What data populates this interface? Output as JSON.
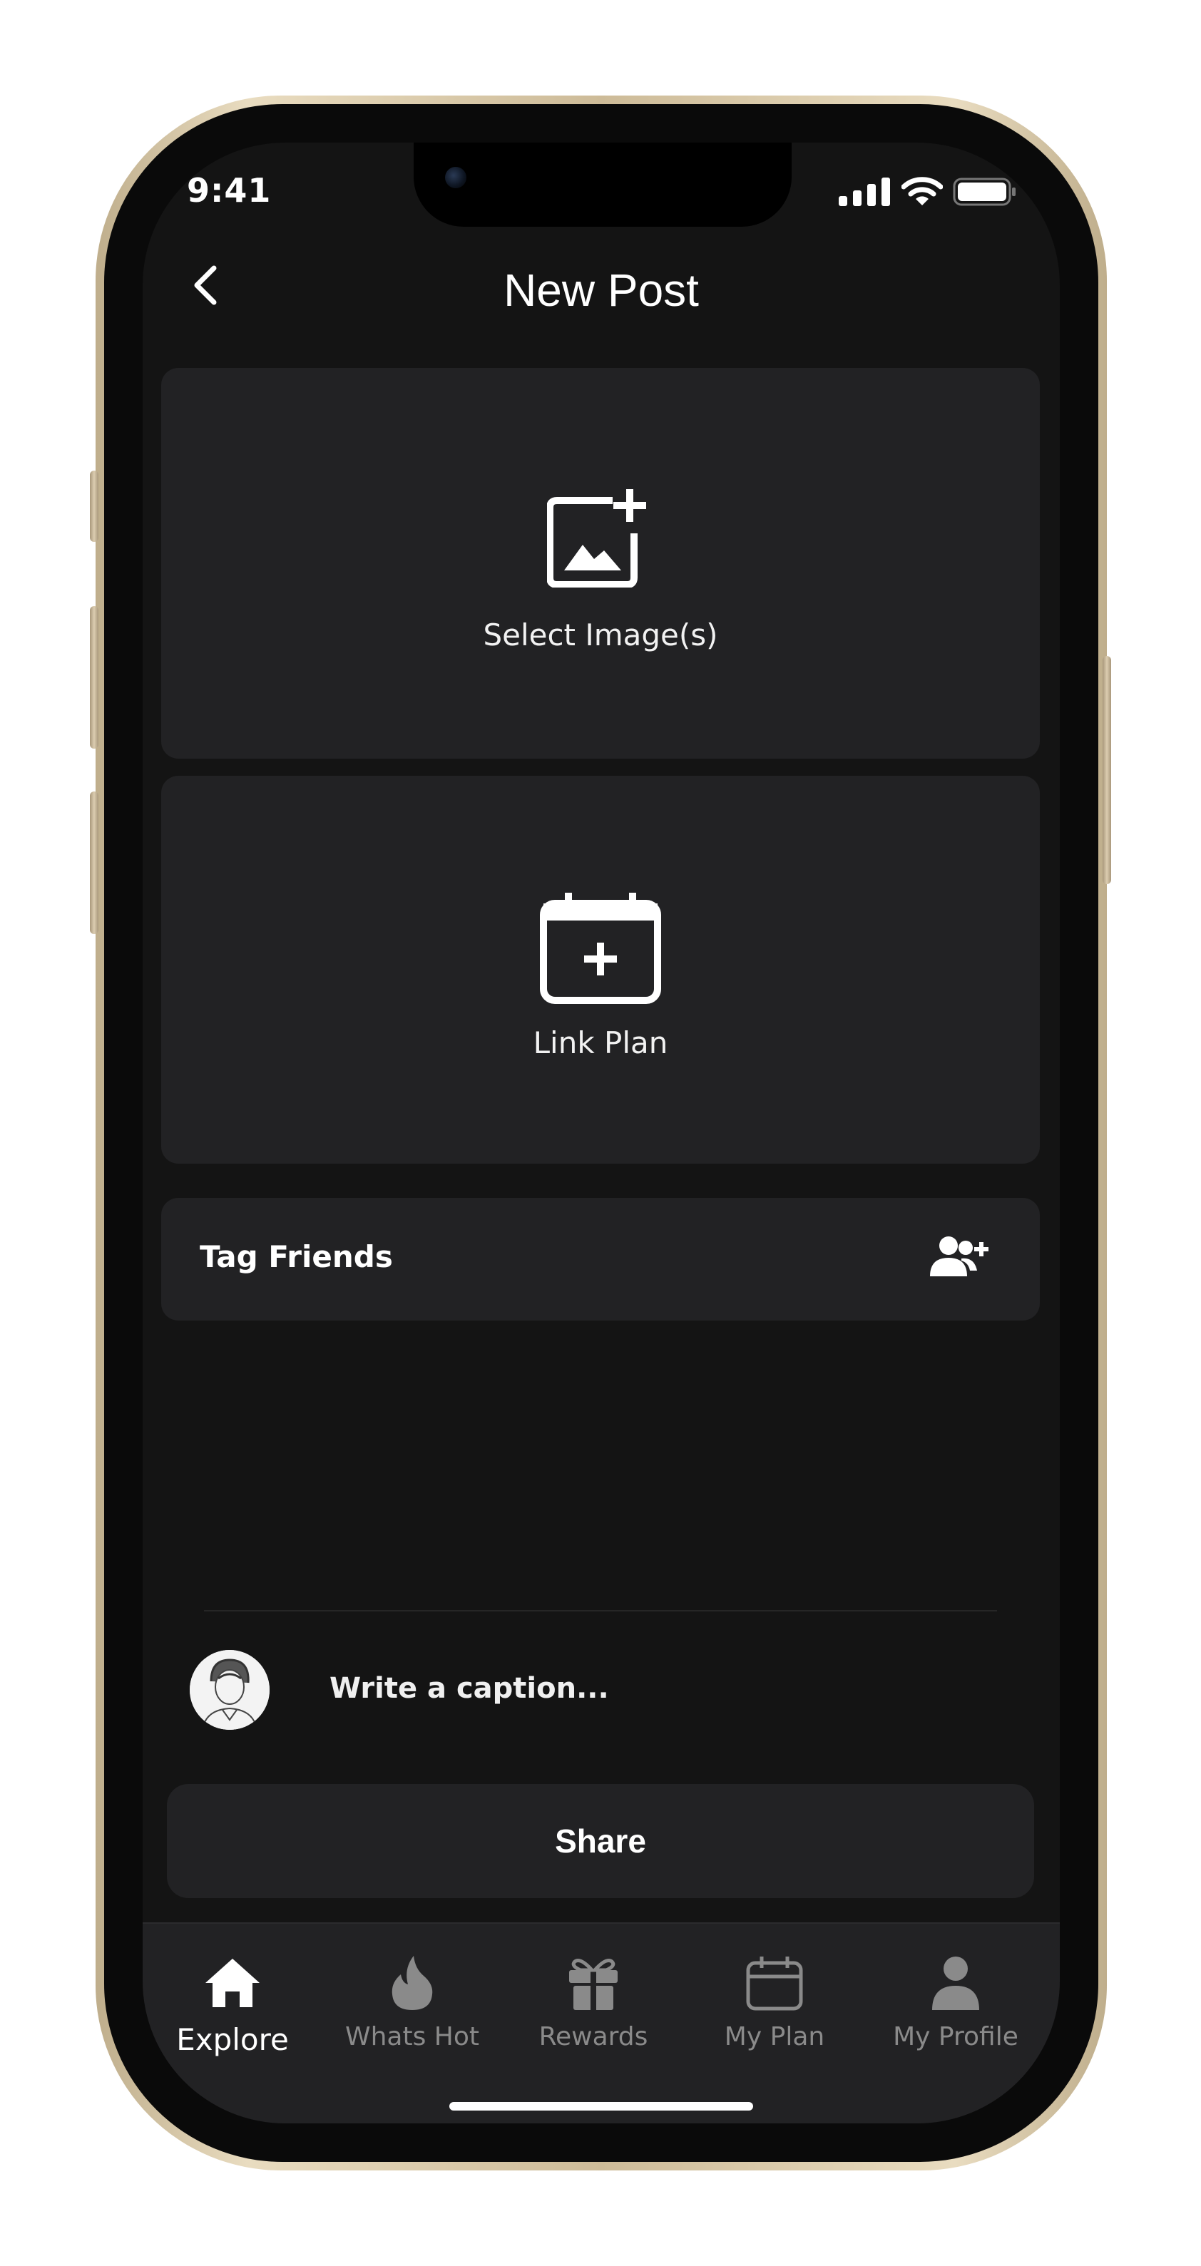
{
  "status_bar": {
    "time": "9:41"
  },
  "header": {
    "title": "New Post"
  },
  "media_card": {
    "label": "Select Image(s)",
    "icon": "add-image-icon"
  },
  "plan_card": {
    "label": "Link Plan",
    "icon": "calendar-plus-icon"
  },
  "tag_friends": {
    "label": "Tag Friends",
    "icon": "user-add-icon"
  },
  "caption": {
    "placeholder": "Write a caption..."
  },
  "share_button": {
    "label": "Share"
  },
  "tabs": [
    {
      "label": "Explore",
      "icon": "home-icon",
      "active": true
    },
    {
      "label": "Whats Hot",
      "icon": "flame-icon",
      "active": false
    },
    {
      "label": "Rewards",
      "icon": "gift-icon",
      "active": false
    },
    {
      "label": "My Plan",
      "icon": "calendar-icon",
      "active": false
    },
    {
      "label": "My Profile",
      "icon": "person-icon",
      "active": false
    }
  ],
  "colors": {
    "background": "#141414",
    "card": "#222224",
    "text": "#ffffff",
    "inactive_tab": "#8a8a8a",
    "phone_frame": "#d9c9a8"
  }
}
